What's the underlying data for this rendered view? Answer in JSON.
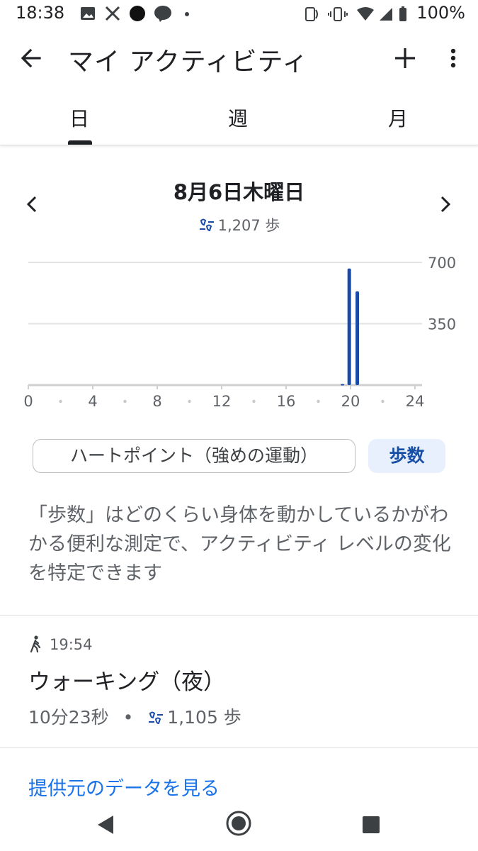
{
  "status_bar": {
    "time": "18:38",
    "battery": "100%"
  },
  "app_bar": {
    "title": "マイ アクティビティ"
  },
  "tabs": [
    {
      "label": "日",
      "selected": true
    },
    {
      "label": "週",
      "selected": false
    },
    {
      "label": "月",
      "selected": false
    }
  ],
  "date_header": {
    "date": "8月6日木曜日",
    "steps": "1,207 歩"
  },
  "chart_data": {
    "type": "bar",
    "x_ticks": [
      "0",
      "4",
      "8",
      "12",
      "16",
      "20",
      "24"
    ],
    "y_ticks": [
      "700",
      "350"
    ],
    "ylim": [
      0,
      700
    ],
    "xlim": [
      0,
      24
    ],
    "grid": true,
    "bar_color": "#1a4aa8",
    "bars": [
      {
        "hour": 19.5,
        "value": 6
      },
      {
        "hour": 19.92,
        "value": 665
      },
      {
        "hour": 20.42,
        "value": 535
      }
    ]
  },
  "chips": {
    "heart_points": "ハートポイント（強めの運動）",
    "steps": "歩数"
  },
  "description": "「歩数」はどのくらい身体を動かしているかがわかる便利な測定で、アクティビティ レベルの変化を特定できます",
  "activity": {
    "time": "19:54",
    "name": "ウォーキング（夜）",
    "duration": "10分23秒",
    "separator": "•",
    "steps": "1,105 歩"
  },
  "source_link": "提供元のデータを見る",
  "colors": {
    "accent": "#1a73e8",
    "bar": "#1a4aa8",
    "chip_selected_bg": "#e8f0fe"
  }
}
